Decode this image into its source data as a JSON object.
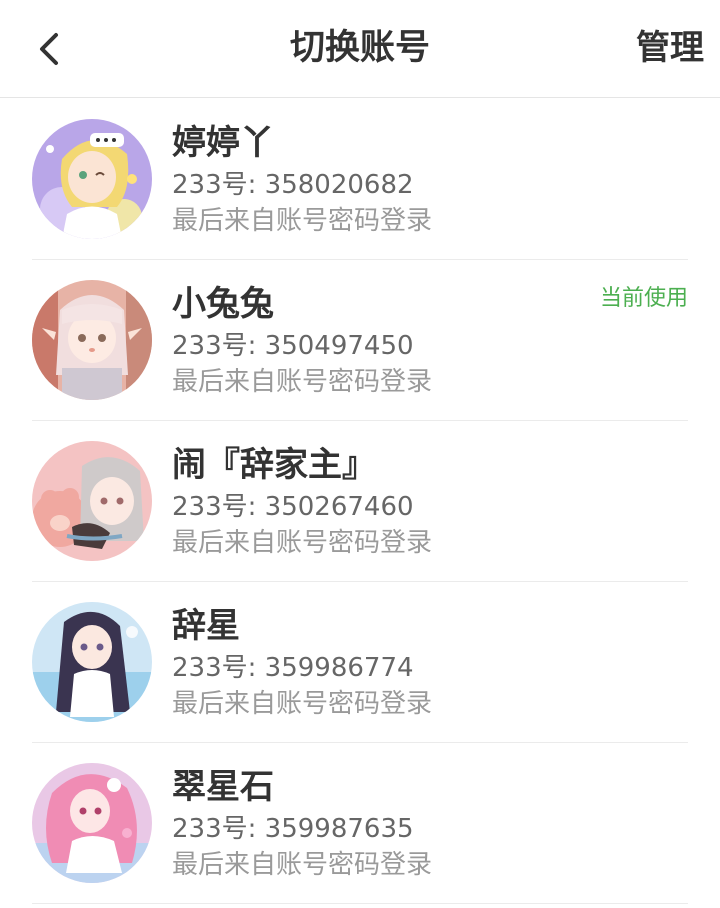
{
  "header": {
    "title": "切换账号",
    "manage_label": "管理",
    "back_icon": "chevron-left-icon"
  },
  "accounts": [
    {
      "name": "婷婷丫",
      "uid": "233号: 358020682",
      "login": "最后来自账号密码登录",
      "badge": ""
    },
    {
      "name": "小兔兔",
      "uid": "233号: 350497450",
      "login": "最后来自账号密码登录",
      "badge": "当前使用"
    },
    {
      "name": "闹『辞家主』",
      "uid": "233号: 350267460",
      "login": "最后来自账号密码登录",
      "badge": ""
    },
    {
      "name": "辞星",
      "uid": "233号: 359986774",
      "login": "最后来自账号密码登录",
      "badge": ""
    },
    {
      "name": "翠星石",
      "uid": "233号: 359987635",
      "login": "最后来自账号密码登录",
      "badge": ""
    }
  ],
  "colors": {
    "accent_green": "#4caf50",
    "text_primary": "#333333",
    "text_secondary": "#666666",
    "text_tertiary": "#9a9a9a"
  }
}
